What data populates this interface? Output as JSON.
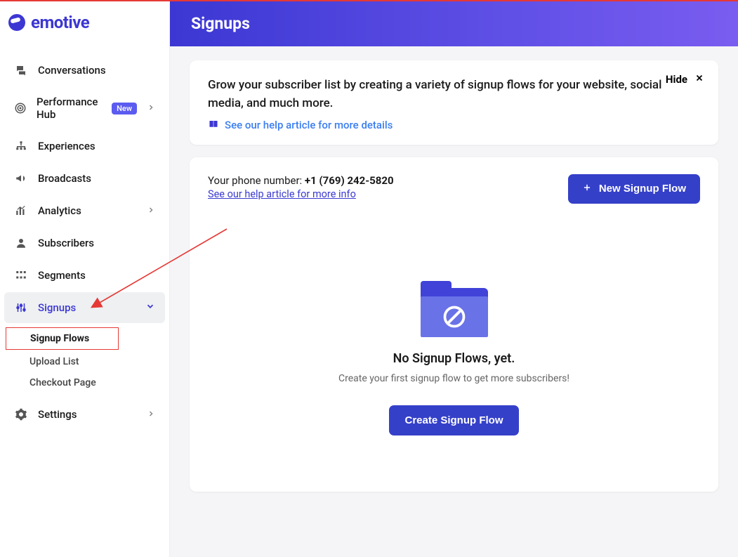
{
  "logo": {
    "text": "emotive"
  },
  "nav": {
    "items": [
      {
        "label": "Conversations"
      },
      {
        "label": "Performance Hub",
        "badge": "New",
        "chevron": true
      },
      {
        "label": "Experiences"
      },
      {
        "label": "Broadcasts"
      },
      {
        "label": "Analytics",
        "chevron": true
      },
      {
        "label": "Subscribers"
      },
      {
        "label": "Segments"
      },
      {
        "label": "Signups",
        "chevron": true,
        "active": true
      },
      {
        "label": "Settings",
        "chevron": true
      }
    ],
    "signups_sub": [
      {
        "label": "Signup Flows",
        "highlight": true
      },
      {
        "label": "Upload List"
      },
      {
        "label": "Checkout Page"
      }
    ]
  },
  "header": {
    "title": "Signups"
  },
  "banner": {
    "text": "Grow your subscriber list by creating a variety of signup flows for your website, social media, and much more.",
    "link": "See our help article for more details",
    "hide": "Hide"
  },
  "panel": {
    "phone_label": "Your phone number: ",
    "phone_number": "+1 (769) 242-5820",
    "info_link": "See our help article for more info",
    "new_btn": "New Signup Flow"
  },
  "empty": {
    "title": "No Signup Flows, yet.",
    "sub": "Create your first signup flow to get more subscribers!",
    "cta": "Create Signup Flow"
  }
}
